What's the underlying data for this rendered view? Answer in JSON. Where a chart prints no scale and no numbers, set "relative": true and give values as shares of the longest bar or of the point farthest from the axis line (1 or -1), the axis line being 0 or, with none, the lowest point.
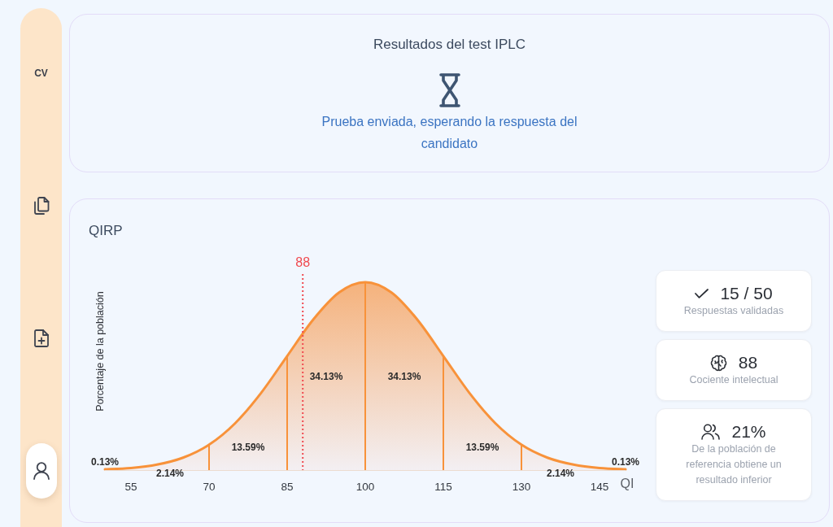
{
  "sidebar": {
    "items": [
      {
        "kind": "text",
        "label": "CV",
        "selected": false
      },
      {
        "kind": "copy",
        "selected": false
      },
      {
        "kind": "file-add",
        "selected": false
      },
      {
        "kind": "user",
        "selected": true
      }
    ]
  },
  "results_card": {
    "title": "Resultados del test IPLC",
    "status": "Prueba enviada, esperando la respuesta del candidato"
  },
  "chart_card": {
    "title": "QIRP",
    "chart_data": {
      "type": "area",
      "xlabel": "QI",
      "ylabel": "Porcentaje de la población",
      "relative": true,
      "x": [
        50,
        55,
        60,
        65,
        70,
        75,
        80,
        85,
        90,
        95,
        100,
        105,
        110,
        115,
        120,
        125,
        130,
        135,
        140,
        145,
        150
      ],
      "values": [
        0.004,
        0.011,
        0.029,
        0.066,
        0.135,
        0.249,
        0.411,
        0.607,
        0.801,
        0.946,
        1,
        0.946,
        0.801,
        0.607,
        0.411,
        0.249,
        0.135,
        0.066,
        0.029,
        0.011,
        0.004
      ],
      "xlim": [
        50,
        150
      ],
      "xticks": [
        55,
        70,
        85,
        100,
        115,
        130,
        145
      ],
      "ref_lines": [
        {
          "axis": "x",
          "value": 88,
          "label": "88"
        },
        {
          "axis": "x",
          "value": 70
        },
        {
          "axis": "x",
          "value": 85
        },
        {
          "axis": "x",
          "value": 100
        },
        {
          "axis": "x",
          "value": 115
        },
        {
          "axis": "x",
          "value": 130
        }
      ],
      "annotations": [
        "0.13%",
        "2.14%",
        "13.59%",
        "34.13%",
        "34.13%",
        "13.59%",
        "2.14%",
        "0.13%"
      ]
    },
    "stats": [
      {
        "kind": "check",
        "value": "15 / 50",
        "label": "Respuestas validadas"
      },
      {
        "kind": "brain",
        "value": "88",
        "label": "Cociente intelectual"
      },
      {
        "kind": "people",
        "value": "21%",
        "label": "De la población de referencia obtiene un resultado inferior"
      }
    ]
  }
}
